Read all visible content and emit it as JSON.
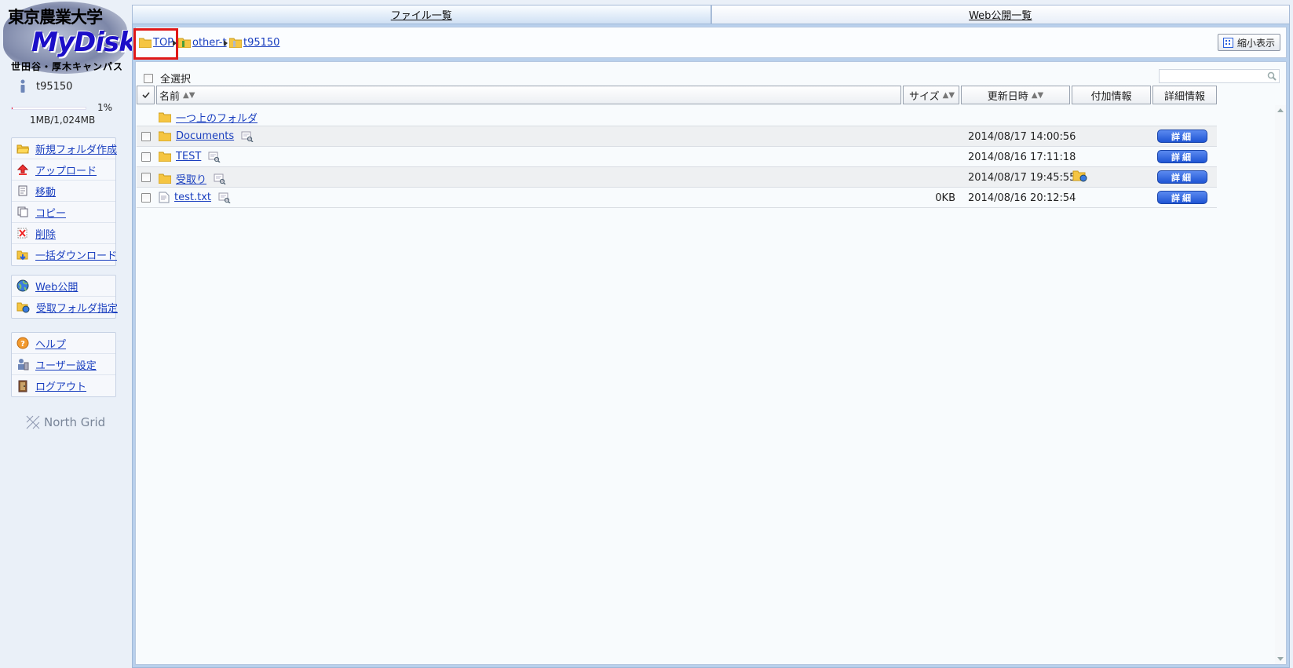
{
  "logo": {
    "line1": "東京農業大学",
    "name": "MyDisk",
    "line2": "世田谷・厚木キャンパス"
  },
  "user": {
    "name": "t95150"
  },
  "quota": {
    "percent_label": "1%",
    "usage": "1MB/1,024MB",
    "fraction": 0.01
  },
  "menu1": [
    {
      "label": "新規フォルダ作成",
      "icon": "folder-open-icon"
    },
    {
      "label": "アップロード",
      "icon": "upload-icon"
    },
    {
      "label": "移動",
      "icon": "move-icon"
    },
    {
      "label": "コピー",
      "icon": "copy-icon"
    },
    {
      "label": "削除",
      "icon": "delete-icon"
    },
    {
      "label": "一括ダウンロード",
      "icon": "download-icon"
    }
  ],
  "menu2": [
    {
      "label": "Web公開",
      "icon": "globe-icon"
    },
    {
      "label": "受取フォルダ指定",
      "icon": "receive-folder-icon"
    }
  ],
  "menu3": [
    {
      "label": "ヘルプ",
      "icon": "help-icon"
    },
    {
      "label": "ユーザー設定",
      "icon": "user-settings-icon"
    },
    {
      "label": "ログアウト",
      "icon": "logout-icon"
    }
  ],
  "footer_brand": "North Grid",
  "tabs": [
    {
      "label": "ファイル一覧",
      "active": true
    },
    {
      "label": "Web公開一覧",
      "active": false
    }
  ],
  "breadcrumb": [
    {
      "label": "TOP",
      "highlighted": true
    },
    {
      "label": "other-t"
    },
    {
      "label": "t95150"
    }
  ],
  "toolbar": {
    "thumbnail_label": "縮小表示",
    "select_all_label": "全選択",
    "search_value": ""
  },
  "columns": {
    "name": "名前",
    "size": "サイズ",
    "updated": "更新日時",
    "extra": "付加情報",
    "details": "詳細情報"
  },
  "parent_folder_label": "一つ上のフォルダ",
  "files": [
    {
      "name": "Documents",
      "type": "folder",
      "size": "",
      "updated": "2014/08/17 14:00:56",
      "extra": "",
      "detail_label": "詳細"
    },
    {
      "name": "TEST",
      "type": "folder",
      "size": "",
      "updated": "2014/08/16 17:11:18",
      "extra": "",
      "detail_label": "詳細"
    },
    {
      "name": "受取り",
      "type": "folder",
      "size": "",
      "updated": "2014/08/17 19:45:55",
      "extra": "receive-folder-icon",
      "detail_label": "詳細"
    },
    {
      "name": "test.txt",
      "type": "file",
      "size": "0KB",
      "updated": "2014/08/16 20:12:54",
      "extra": "",
      "detail_label": "詳細"
    }
  ],
  "colors": {
    "link": "#1a3fbf",
    "highlight_box": "#e01818",
    "detail_button": "#2a5fdc",
    "frame": "#b9d0ec"
  }
}
